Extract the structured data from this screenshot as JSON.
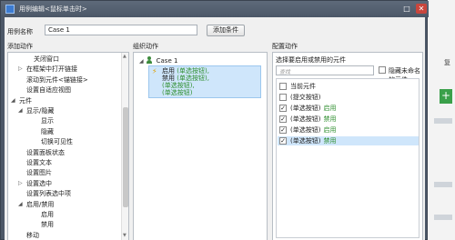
{
  "titlebar": {
    "title": "用例编辑<鼠标单击时>"
  },
  "case": {
    "label": "用例名称",
    "value": "Case 1",
    "add_condition": "添加条件"
  },
  "columns": {
    "left": "添加动作",
    "middle": "组织动作",
    "right": "配置动作"
  },
  "left_tree": [
    {
      "label": "关闭窗口",
      "indent": 2,
      "arrow": ""
    },
    {
      "label": "在框架中打开链接",
      "indent": 1,
      "arrow": "▷"
    },
    {
      "label": "滚动到元件<锚链接>",
      "indent": 1,
      "arrow": ""
    },
    {
      "label": "设置自适应视图",
      "indent": 1,
      "arrow": ""
    },
    {
      "label": "元件",
      "indent": 0,
      "arrow": "◢"
    },
    {
      "label": "显示/隐藏",
      "indent": 1,
      "arrow": "◢"
    },
    {
      "label": "显示",
      "indent": 3,
      "arrow": ""
    },
    {
      "label": "隐藏",
      "indent": 3,
      "arrow": ""
    },
    {
      "label": "切换可见性",
      "indent": 3,
      "arrow": ""
    },
    {
      "label": "设置面板状态",
      "indent": 1,
      "arrow": ""
    },
    {
      "label": "设置文本",
      "indent": 1,
      "arrow": ""
    },
    {
      "label": "设置图片",
      "indent": 1,
      "arrow": ""
    },
    {
      "label": "设置选中",
      "indent": 1,
      "arrow": "▷"
    },
    {
      "label": "设置列表选中项",
      "indent": 1,
      "arrow": ""
    },
    {
      "label": "启用/禁用",
      "indent": 1,
      "arrow": "◢"
    },
    {
      "label": "启用",
      "indent": 3,
      "arrow": ""
    },
    {
      "label": "禁用",
      "indent": 3,
      "arrow": ""
    },
    {
      "label": "移动",
      "indent": 1,
      "arrow": ""
    }
  ],
  "middle": {
    "case_name": "Case 1",
    "action_lines": [
      {
        "plain": "启用 ",
        "green": "(单选按钮),"
      },
      {
        "plain": "禁用 ",
        "green": "(单选按钮),"
      },
      {
        "plain": "",
        "green": "(单选按钮),"
      },
      {
        "plain": "",
        "green": "(单选按钮)"
      }
    ]
  },
  "right": {
    "select_label": "选择要启用或禁用的元件",
    "filter_placeholder": "查找",
    "hide_unnamed": "隐藏未命名的元件",
    "items": [
      {
        "checked": false,
        "name": "当前元件",
        "status": "",
        "selected": false
      },
      {
        "checked": false,
        "name": "(提交按钮)",
        "status": "",
        "selected": false
      },
      {
        "checked": true,
        "name": "(单选按钮)",
        "status": "启用",
        "selected": false
      },
      {
        "checked": true,
        "name": "(单选按钮)",
        "status": "禁用",
        "selected": false
      },
      {
        "checked": true,
        "name": "(单选按钮)",
        "status": "启用",
        "selected": false
      },
      {
        "checked": true,
        "name": "(单选按钮)",
        "status": "禁用",
        "selected": true
      }
    ]
  },
  "background": {
    "text": "复"
  }
}
